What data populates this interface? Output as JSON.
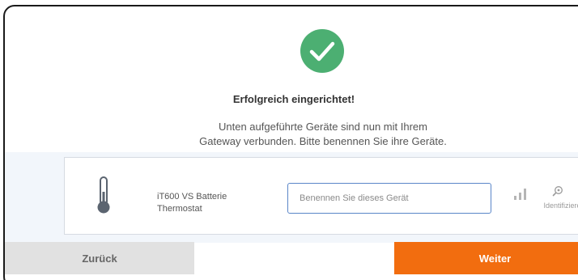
{
  "dialog": {
    "title": "Erfolgreich eingerichtet!",
    "description_line1": "Unten aufgeführte Geräte sind nun mit Ihrem",
    "description_line2": "Gateway verbunden. Bitte benennen Sie ihre Geräte.",
    "success_icon": "checkmark-circle-icon",
    "accent_color": "#4caf72"
  },
  "device": {
    "icon": "thermometer-icon",
    "name_line1": "iT600 VS Batterie",
    "name_line2": "Thermostat",
    "name_input_value": "",
    "name_input_placeholder": "Benennen Sie dieses Gerät",
    "signal_icon": "signal-strength-icon",
    "identify_icon": "magnifier-icon",
    "identify_label": "Identifizieren"
  },
  "footer": {
    "back_label": "Zurück",
    "next_label": "Weiter",
    "next_color": "#f26d0f",
    "back_color": "#e1e1e1"
  }
}
